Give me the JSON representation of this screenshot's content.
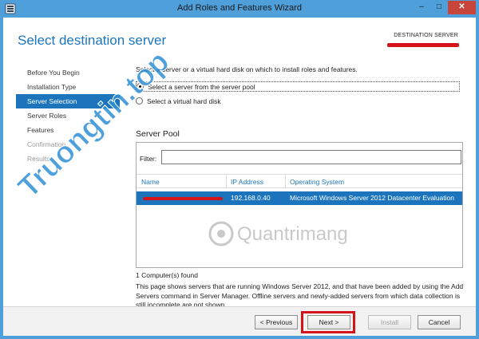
{
  "window": {
    "title": "Add Roles and Features Wizard",
    "minimize_glyph": "–",
    "maximize_glyph": "□",
    "close_glyph": "✕"
  },
  "header": {
    "page_title": "Select destination server",
    "destination_label": "DESTINATION SERVER"
  },
  "nav": {
    "items": [
      {
        "label": "Before You Begin",
        "state": "normal"
      },
      {
        "label": "Installation Type",
        "state": "normal"
      },
      {
        "label": "Server Selection",
        "state": "active"
      },
      {
        "label": "Server Roles",
        "state": "normal"
      },
      {
        "label": "Features",
        "state": "normal"
      },
      {
        "label": "Confirmation",
        "state": "disabled"
      },
      {
        "label": "Results",
        "state": "disabled"
      }
    ]
  },
  "content": {
    "description": "Select a server or a virtual hard disk on which to install roles and features.",
    "options": [
      {
        "label": "Select a server from the server pool",
        "checked": true
      },
      {
        "label": "Select a virtual hard disk",
        "checked": false
      }
    ],
    "pool_label": "Server Pool",
    "filter_label": "Filter:",
    "filter_value": "",
    "columns": [
      "Name",
      "IP Address",
      "Operating System"
    ],
    "rows": [
      {
        "ip": "192.168.0.40",
        "os": "Microsoft Windows Server 2012 Datacenter Evaluation"
      }
    ],
    "count_text": "1 Computer(s) found",
    "note": "This page shows servers that are running Windows Server 2012, and that have been added by using the Add Servers command in Server Manager. Offline servers and newly-added servers from which data collection is still incomplete are not shown."
  },
  "footer": {
    "previous": "< Previous",
    "next": "Next >",
    "install": "Install",
    "cancel": "Cancel"
  },
  "watermarks": {
    "left": "Truongtin.top",
    "center": "Quantrimang"
  },
  "colors": {
    "accent": "#1c75bc",
    "titlebar": "#4f9fdb",
    "highlight_red": "#d4141a"
  }
}
